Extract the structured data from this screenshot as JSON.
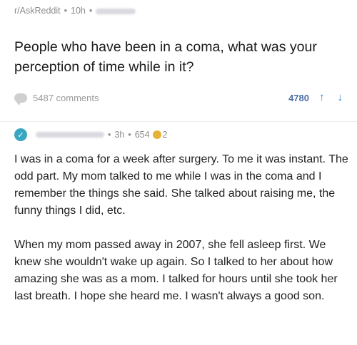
{
  "post": {
    "subreddit": "r/AskReddit",
    "age": "10h",
    "separator": "•",
    "title": "People who have been in a coma, what was your perception of time while in it?",
    "comments_count": "5487 comments",
    "score": "4780"
  },
  "comment": {
    "age": "3h",
    "points": "654",
    "awards": "2",
    "separator": "•",
    "paragraphs": [
      "I was in a coma for a week after surgery.  To me it was instant.  The odd part.  My mom talked to me while I was in the coma and I remember the things she said.  She talked about raising me, the funny things I did, etc.",
      "When my mom passed away in 2007, she fell asleep first.  We knew she wouldn't wake up again.  So I talked to her about how amazing she was as a mom.  I talked for hours until she took her last breath.  I hope she heard me. I wasn't always a good son."
    ]
  },
  "colors": {
    "accent_blue": "#2e7fd6",
    "score_blue": "#4a6fa5",
    "meta_gray": "#8c8c8c",
    "avatar_teal": "#3aa7c2",
    "award_gold": "#e8b23a"
  },
  "icons": {
    "comments": "comment-bubble-icon",
    "upvote": "arrow-up-icon",
    "downvote": "arrow-down-icon",
    "avatar": "check-badge-icon",
    "award": "coin-award-icon"
  }
}
